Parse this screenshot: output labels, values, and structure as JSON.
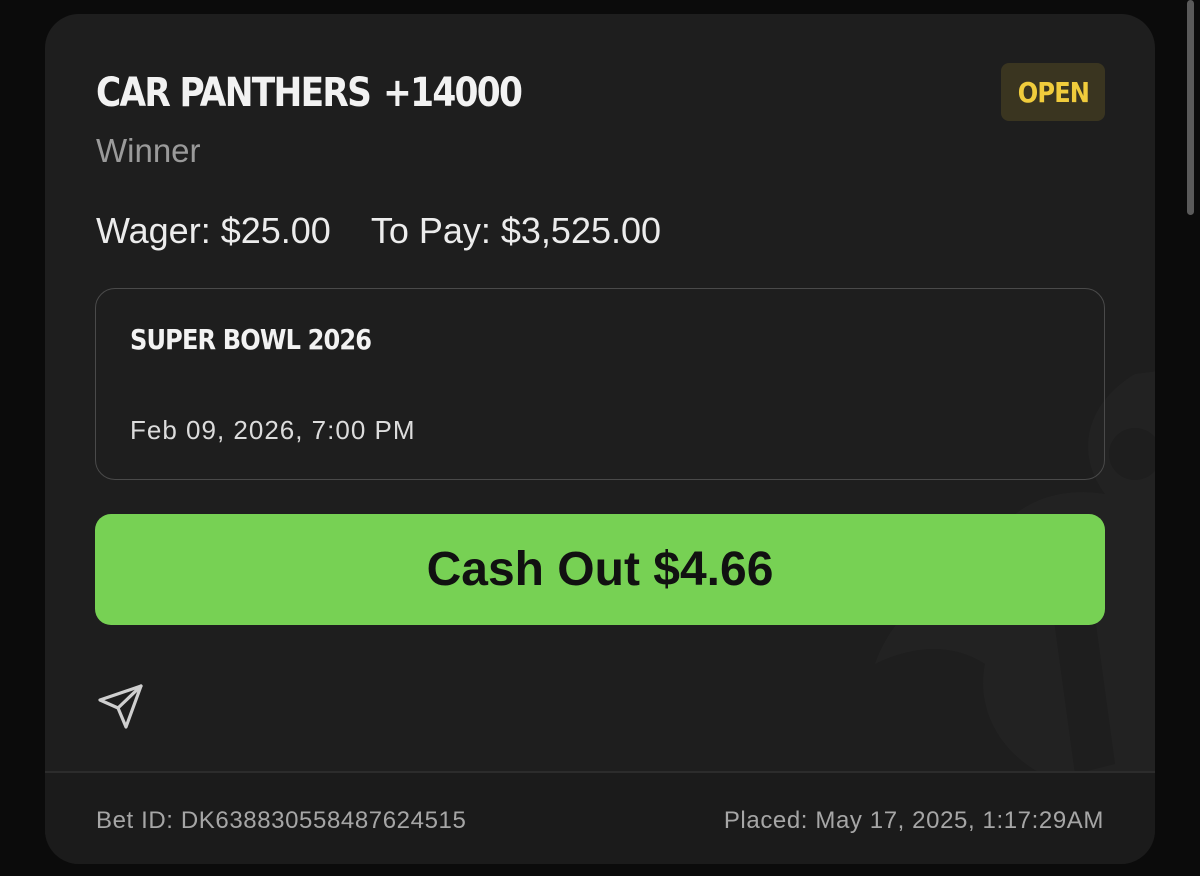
{
  "bet": {
    "team": "CAR PANTHERS",
    "odds": "+14000",
    "status": "OPEN",
    "market": "Winner",
    "wager": "Wager: $25.00",
    "to_pay": "To Pay: $3,525.00"
  },
  "event": {
    "name": "SUPER BOWL 2026",
    "date": "Feb 09, 2026, 7:00 PM"
  },
  "cash_out": {
    "label": "Cash Out $4.66"
  },
  "share": {
    "icon": "paper-plane-icon"
  },
  "footer": {
    "bet_id": "Bet ID: DK638830558487624515",
    "placed": "Placed: May 17, 2025, 1:17:29AM"
  },
  "colors": {
    "card_bg": "#1e1e1e",
    "accent_green": "#77d154",
    "status_yellow": "#f0cc3c",
    "status_bg": "#3a3520"
  }
}
